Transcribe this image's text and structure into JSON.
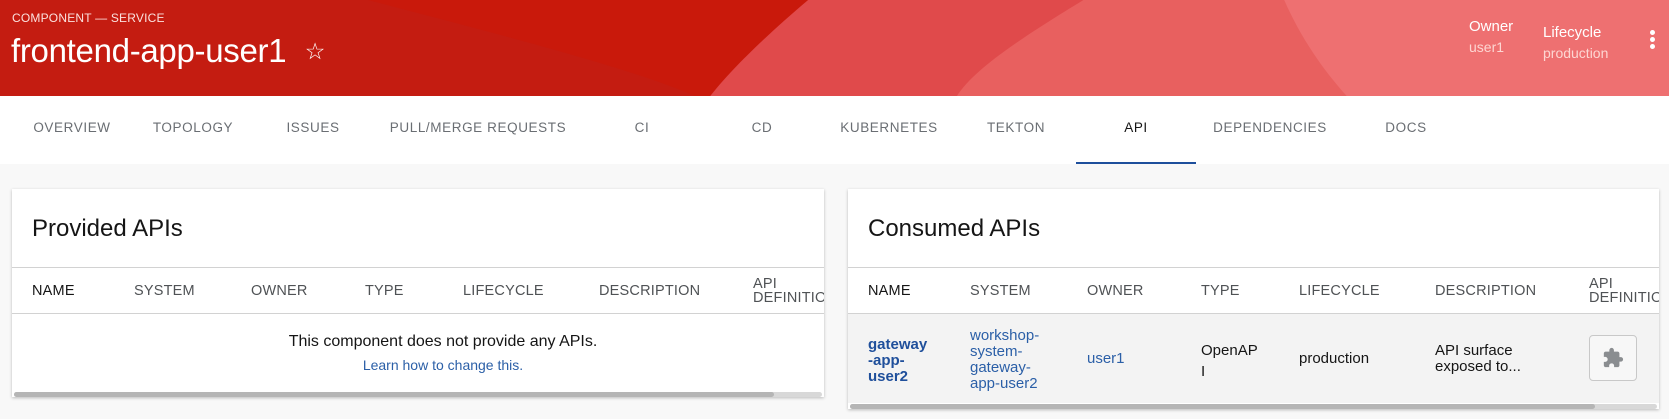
{
  "header": {
    "eyebrow": "COMPONENT — SERVICE",
    "title": "frontend-app-user1",
    "star_icon": "☆",
    "owner_label": "Owner",
    "owner_value": "user1",
    "lifecycle_label": "Lifecycle",
    "lifecycle_value": "production"
  },
  "colors": {
    "header_red": "#c9190b",
    "active_tab_underline": "#1e4f9c",
    "link": "#2b5fa7"
  },
  "tabs": [
    {
      "label": "OVERVIEW"
    },
    {
      "label": "TOPOLOGY"
    },
    {
      "label": "ISSUES"
    },
    {
      "label": "PULL/MERGE REQUESTS"
    },
    {
      "label": "CI"
    },
    {
      "label": "CD"
    },
    {
      "label": "KUBERNETES"
    },
    {
      "label": "TEKTON"
    },
    {
      "label": "API",
      "active": true
    },
    {
      "label": "DEPENDENCIES"
    },
    {
      "label": "DOCS"
    }
  ],
  "provided": {
    "title": "Provided APIs",
    "columns": [
      "NAME",
      "SYSTEM",
      "OWNER",
      "TYPE",
      "LIFECYCLE",
      "DESCRIPTION",
      "API",
      "DEFINITIO"
    ],
    "empty_message": "This component does not provide any APIs.",
    "learn_link": "Learn how to change this."
  },
  "consumed": {
    "title": "Consumed APIs",
    "columns": [
      "NAME",
      "SYSTEM",
      "OWNER",
      "TYPE",
      "LIFECYCLE",
      "DESCRIPTION",
      "API",
      "DEFINITIO"
    ],
    "row": {
      "name_lines": [
        "gateway",
        "-app-",
        "user2"
      ],
      "system_lines": [
        "workshop-",
        "system-",
        "gateway-",
        "app-user2"
      ],
      "owner": "user1",
      "type_lines": [
        "OpenAP",
        "I"
      ],
      "lifecycle": "production",
      "description_lines": [
        "API surface",
        "exposed to..."
      ],
      "definition_icon": "puzzle-piece-icon"
    }
  }
}
